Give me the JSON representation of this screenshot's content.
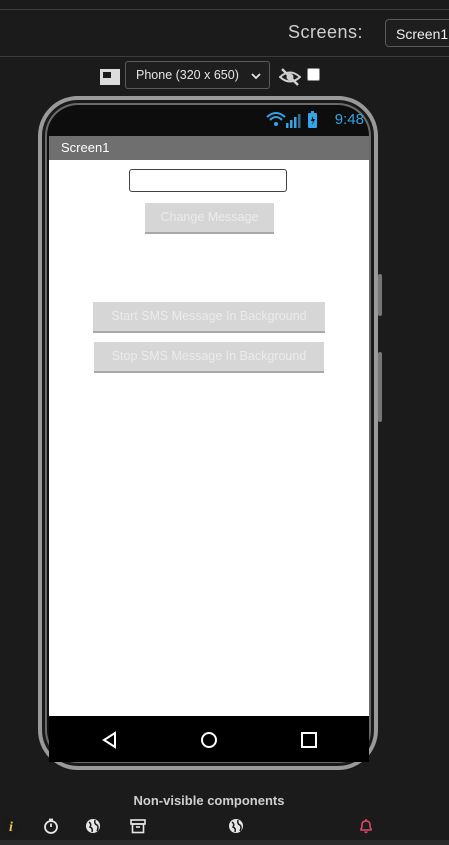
{
  "header": {
    "screens_label": "Screens:",
    "screen_select_value": "Screen1"
  },
  "toolbar": {
    "device_select_value": "Phone (320 x 650)",
    "hidden_components_checked": false
  },
  "phone": {
    "status_time": "9:48",
    "screen_title": "Screen1",
    "textbox_value": "",
    "buttons": {
      "change_message": "Change Message",
      "start_sms": "Start SMS Message In Background",
      "stop_sms": "Stop SMS Message In Background"
    }
  },
  "footer": {
    "nonvisible_label": "Non-visible components",
    "icons": [
      "info-icon",
      "clock-icon",
      "web-globe-icon",
      "archive-icon",
      "web-globe-icon",
      "notifier-bell-icon"
    ]
  },
  "colors": {
    "accent_blue": "#36a3e5",
    "notifier_red": "#e0476a"
  }
}
